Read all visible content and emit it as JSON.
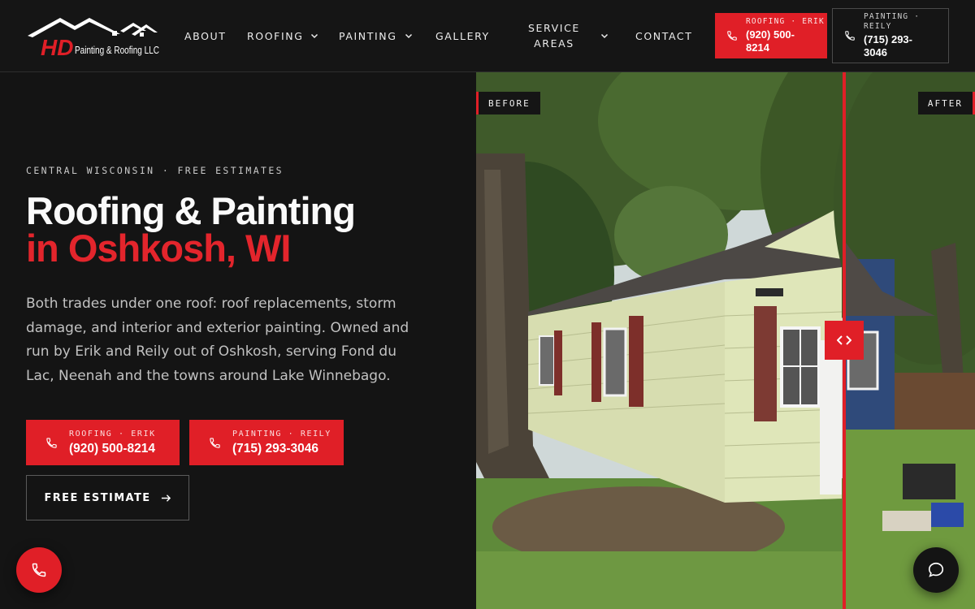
{
  "brand": {
    "logo_letters": "HD",
    "logo_text": "Painting & Roofing LLC"
  },
  "nav": {
    "about": "ABOUT",
    "roofing": "ROOFING",
    "painting": "PAINTING",
    "gallery": "GALLERY",
    "service_l1": "SERVICE",
    "service_l2": "AREAS",
    "contact": "CONTACT"
  },
  "header_calls": {
    "roofing": {
      "label": "ROOFING · ERIK",
      "number_l1": "(920) 500-",
      "number_l2": "8214"
    },
    "painting": {
      "label_l1": "PAINTING ·",
      "label_l2": "REILY",
      "number_l1": "(715) 293-",
      "number_l2": "3046"
    }
  },
  "hero": {
    "eyebrow": "CENTRAL WISCONSIN · FREE ESTIMATES",
    "title_line1": "Roofing & Painting",
    "title_line2": "in Oshkosh, WI",
    "lead": "Both trades under one roof: roof replacements, storm damage, and interior and exterior painting. Owned and run by Erik and Reily out of Oshkosh, serving Fond du Lac, Neenah and the towns around Lake Winnebago.",
    "cta_roofing": {
      "label": "ROOFING · ERIK",
      "number": "(920) 500-8214"
    },
    "cta_painting": {
      "label": "PAINTING · REILY",
      "number": "(715) 293-3046"
    },
    "estimate": "FREE ESTIMATE"
  },
  "compare": {
    "before": "BEFORE",
    "after": "AFTER",
    "slider_position": 0.74
  },
  "colors": {
    "accent": "#e01f27",
    "background": "#141414",
    "siding_before": "#dfe6b9",
    "siding_after": "#2f4a7a"
  },
  "icons": [
    "phone-icon",
    "chevron-down-icon",
    "arrow-right-icon",
    "chat-icon",
    "compare-arrows-icon"
  ]
}
